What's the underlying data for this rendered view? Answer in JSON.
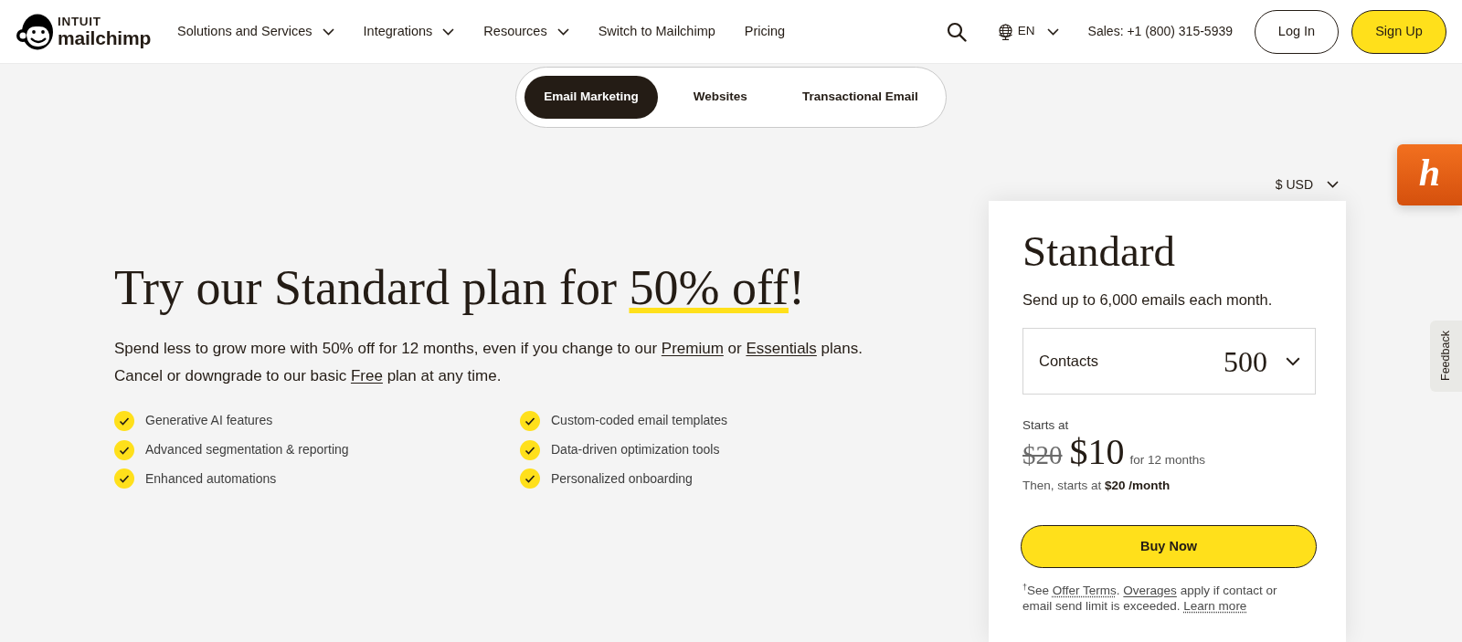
{
  "header": {
    "brand": {
      "company": "INTUIT",
      "product": "mailchimp"
    },
    "nav": [
      {
        "label": "Solutions and Services",
        "dropdown": true
      },
      {
        "label": "Integrations",
        "dropdown": true
      },
      {
        "label": "Resources",
        "dropdown": true
      },
      {
        "label": "Switch to Mailchimp",
        "dropdown": false
      },
      {
        "label": "Pricing",
        "dropdown": false
      }
    ],
    "language": "EN",
    "sales": "Sales: +1 (800) 315-5939",
    "buttons": [
      {
        "label": "Log In",
        "kind": "outline"
      },
      {
        "label": "Sign Up",
        "kind": "primary"
      }
    ]
  },
  "product_tabs": [
    {
      "label": "Email Marketing",
      "selected": true
    },
    {
      "label": "Websites",
      "selected": false
    },
    {
      "label": "Transactional Email",
      "selected": false
    }
  ],
  "hero": {
    "title": [
      {
        "text": "Try our Standard plan for ",
        "highlight": false
      },
      {
        "text": "50% off",
        "highlight": true
      },
      {
        "text": "!",
        "highlight": false
      }
    ],
    "intro": [
      [
        {
          "text": "Spend less to grow more with 50% off for 12 months, even if you change to our ",
          "link": false
        },
        {
          "text": "Premium",
          "link": true
        },
        {
          "text": " or ",
          "link": false
        },
        {
          "text": "Essentials",
          "link": true
        },
        {
          "text": " plans.",
          "link": false
        }
      ],
      [
        {
          "text": "Cancel or downgrade to our basic ",
          "link": false
        },
        {
          "text": "Free",
          "link": true
        },
        {
          "text": " plan at any time.",
          "link": false
        }
      ]
    ],
    "features": [
      [
        "Generative AI features",
        "Advanced segmentation & reporting",
        "Enhanced automations"
      ],
      [
        "Custom-coded email templates",
        "Data-driven optimization tools",
        "Personalized onboarding"
      ]
    ]
  },
  "currency": "$ USD",
  "plan_card": {
    "name": "Standard",
    "description": "Send up to 6,000 emails each month.",
    "contacts": {
      "label": "Contacts",
      "value": "500"
    },
    "starts_at": "Starts at",
    "original_price": "$20",
    "price": "$10",
    "price_term": "for 12 months",
    "renewal": "Then, starts at **$20 /month**",
    "button": "Buy Now",
    "footnote": [
      {
        "text": "$^{†}$See ",
        "link": false
      },
      {
        "text": "Offer Terms",
        "link": true,
        "dotted": true
      },
      {
        "text": ". ",
        "link": false
      },
      {
        "text": "Overages",
        "link": true,
        "dotted": false
      },
      {
        "text": " apply if contact or email send limit is exceeded. ",
        "link": false
      },
      {
        "text": "Learn more",
        "link": true,
        "dotted": true
      }
    ]
  },
  "honey_button": {
    "label": "h"
  },
  "feedback_tab": {
    "label": "Feedback"
  }
}
